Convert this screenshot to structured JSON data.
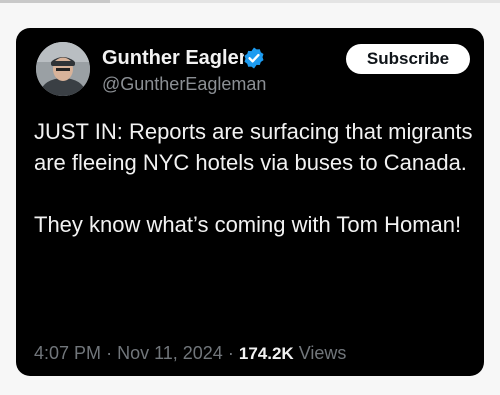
{
  "tweet": {
    "author": {
      "display_name": "Gunther Eagleman",
      "handle": "@GuntherEagleman",
      "verified": true
    },
    "subscribe_label": "Subscribe",
    "paragraphs": [
      "JUST IN: Reports are surfacing that migrants are fleeing NYC hotels via buses to Canada.",
      "They know what’s coming with Tom Homan!"
    ],
    "time": "4:07 PM",
    "separator": "·",
    "date": "Nov 11, 2024",
    "views_count": "174.2K",
    "views_label": "Views"
  },
  "colors": {
    "card_background": "#000000",
    "text_primary": "#f2f2f2",
    "text_secondary": "#71767b",
    "verified_badge": "#1d9bf0",
    "subscribe_background": "#ffffff"
  }
}
